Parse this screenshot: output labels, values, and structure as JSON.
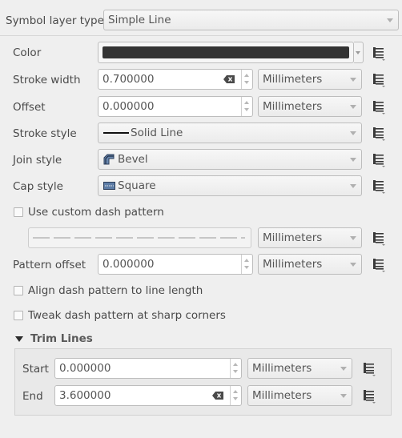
{
  "symbol_layer": {
    "label": "Symbol layer type",
    "value": "Simple Line"
  },
  "color": {
    "label": "Color",
    "swatch": "#333333"
  },
  "stroke_width": {
    "label": "Stroke width",
    "value": "0.700000",
    "unit": "Millimeters"
  },
  "offset": {
    "label": "Offset",
    "value": "0.000000",
    "unit": "Millimeters"
  },
  "stroke_style": {
    "label": "Stroke style",
    "value": "Solid Line"
  },
  "join_style": {
    "label": "Join style",
    "value": "Bevel"
  },
  "cap_style": {
    "label": "Cap style",
    "value": "Square"
  },
  "custom_dash": {
    "label": "Use custom dash pattern",
    "checked": false,
    "unit": "Millimeters"
  },
  "pattern_offset": {
    "label": "Pattern offset",
    "value": "0.000000",
    "unit": "Millimeters"
  },
  "align_dash": {
    "label": "Align dash pattern to line length",
    "checked": false
  },
  "tweak_dash": {
    "label": "Tweak dash pattern at sharp corners",
    "checked": false
  },
  "trim_lines": {
    "title": "Trim Lines",
    "start": {
      "label": "Start",
      "value": "0.000000",
      "unit": "Millimeters"
    },
    "end": {
      "label": "End",
      "value": "3.600000",
      "unit": "Millimeters"
    }
  },
  "colors": {
    "accent_dark": "#333333",
    "background": "#efefef"
  }
}
